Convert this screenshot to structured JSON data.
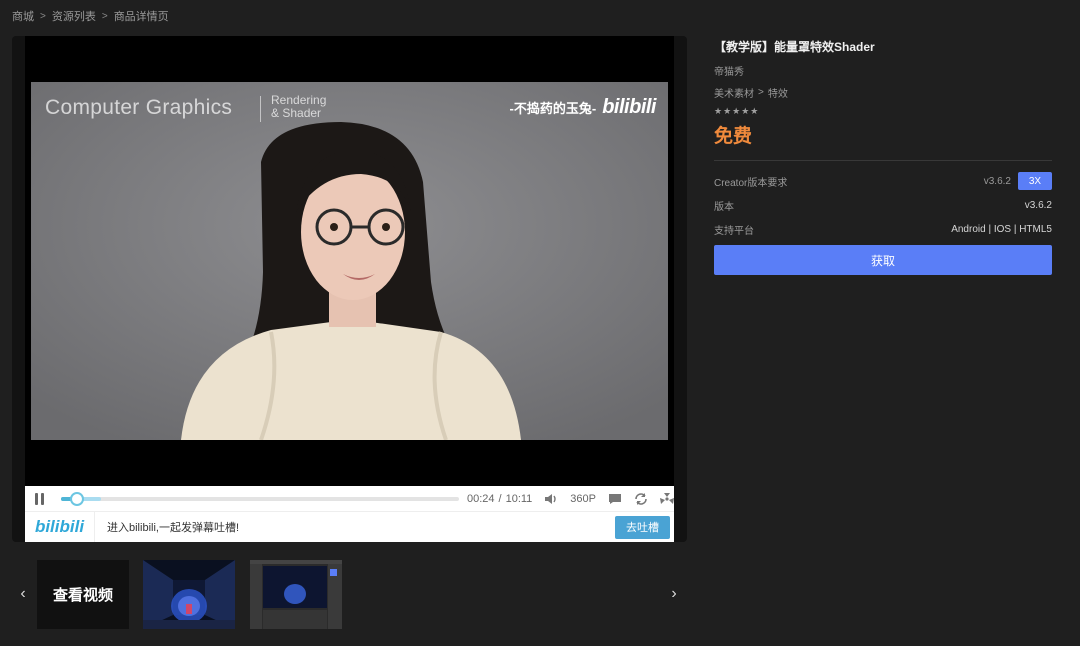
{
  "breadcrumb": [
    "商城",
    "资源列表",
    "商品详情页"
  ],
  "video": {
    "overlay_title": "Computer Graphics",
    "overlay_sub1": "Rendering",
    "overlay_sub2": "& Shader",
    "watermark_text": "-不捣药的玉兔-",
    "watermark_logo": "bilibili",
    "time_current": "00:24",
    "time_sep": "/",
    "time_total": "10:11",
    "quality": "360P",
    "progress_fraction": 0.04,
    "buffer_fraction": 0.1,
    "danmu_logo": "bilibili",
    "danmu_prompt": "进入bilibili,一起发弹幕吐槽!",
    "danmu_button": "去吐槽"
  },
  "thumbs": {
    "video_label": "查看视频",
    "prev": "‹",
    "next": "›"
  },
  "product": {
    "title": "【教学版】能量罩特效Shader",
    "author": "帝猫秀",
    "category_1": "美术素材",
    "category_2": "特效",
    "stars": "★★★★★",
    "price": "免费",
    "spec_label_1": "Creator版本要求",
    "spec_value_1": "v3.6.2",
    "spec_tag_1": "3X",
    "spec_label_2": "版本",
    "spec_value_2": "v3.6.2",
    "spec_label_3": "支持平台",
    "spec_value_3": "Android | IOS | HTML5",
    "get_button": "获取"
  },
  "colors": {
    "accent": "#5a7ef7",
    "price": "#f08a3c",
    "bilibili": "#2fa8d8"
  }
}
